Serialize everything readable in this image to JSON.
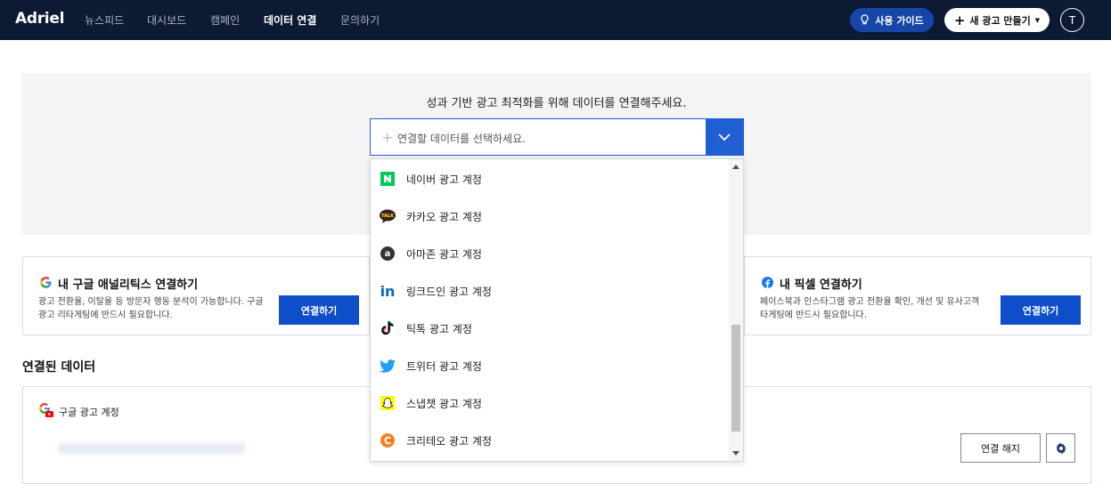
{
  "nav": {
    "logo": "Adriel",
    "items": [
      {
        "label": "뉴스피드",
        "active": false
      },
      {
        "label": "대시보드",
        "active": false
      },
      {
        "label": "캠페인",
        "active": false
      },
      {
        "label": "데이터 연결",
        "active": true
      },
      {
        "label": "문의하기",
        "active": false
      }
    ],
    "guide_label": "사용 가이드",
    "new_ad_label": "새 광고 만들기",
    "avatar_initial": "T"
  },
  "hero": {
    "title": "성과 기반 광고 최적화를 위해 데이터를 연결해주세요.",
    "select_placeholder": "연결할 데이터를 선택하세요."
  },
  "dropdown": {
    "items": [
      {
        "label": "네이버 광고 계정",
        "icon": "naver-icon"
      },
      {
        "label": "카카오 광고 계정",
        "icon": "kakao-icon"
      },
      {
        "label": "아마존 광고 계정",
        "icon": "amazon-icon"
      },
      {
        "label": "링크드인 광고 계정",
        "icon": "linkedin-icon"
      },
      {
        "label": "틱톡 광고 계정",
        "icon": "tiktok-icon"
      },
      {
        "label": "트위터 광고 계정",
        "icon": "twitter-icon"
      },
      {
        "label": "스냅챗 광고 계정",
        "icon": "snapchat-icon"
      },
      {
        "label": "크리테오 광고 계정",
        "icon": "criteo-icon"
      }
    ]
  },
  "cards": {
    "ga": {
      "title": "내 구글 애널리틱스 연결하기",
      "desc1": "광고 전환율, 이탈율 등 방문자 행동 분석이 가능합니다. 구글",
      "desc2": "광고 리타게팅에 반드시 필요합니다.",
      "button": "연결하기"
    },
    "pixel": {
      "title": "내 픽셀 연결하기",
      "desc1": "페이스북과 인스타그램 광고 전환율 확인, 개선 및 유사고객",
      "desc2": "타게팅에 반드시 필요합니다.",
      "button": "연결하기"
    }
  },
  "connected": {
    "section_title": "연결된 데이터",
    "google_ads_label": "구글 광고 계정",
    "disconnect_label": "연결 해지"
  },
  "colors": {
    "nav_bg": "#0d1a33",
    "primary": "#0e4fc9",
    "hero_bg": "#f3f4f6"
  }
}
